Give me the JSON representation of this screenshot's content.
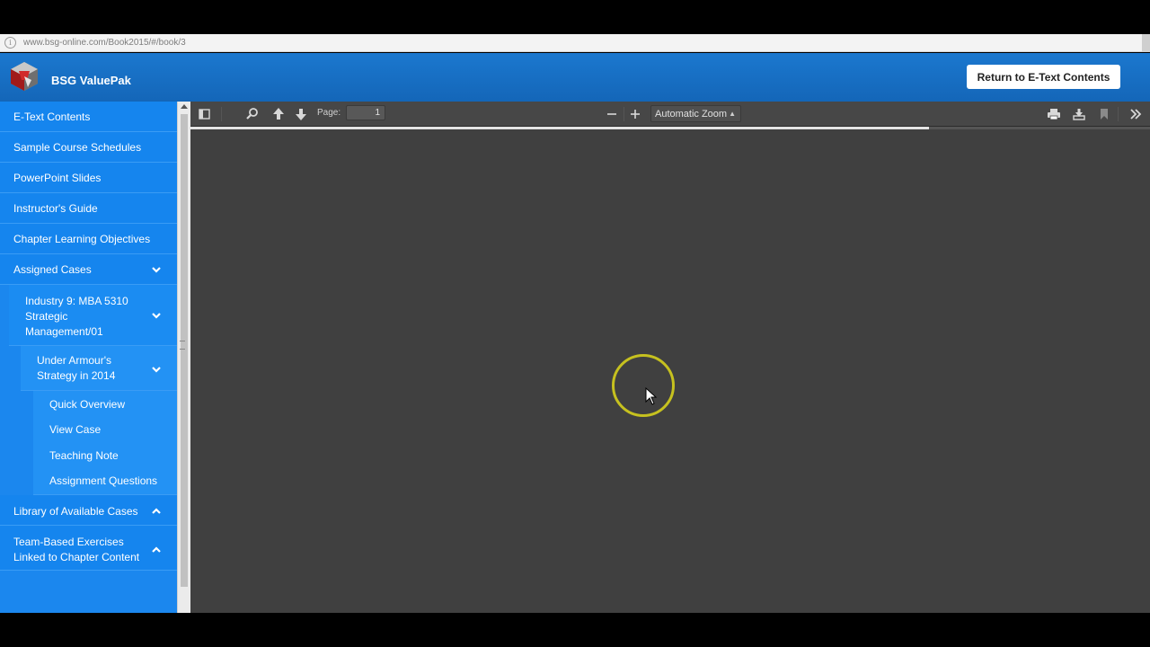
{
  "browser": {
    "url": "www.bsg-online.com/Book2015/#/book/3"
  },
  "header": {
    "brand": "BSG ValuePak",
    "return_button": "Return to E-Text Contents"
  },
  "sidebar": {
    "items": [
      {
        "label": "E-Text Contents"
      },
      {
        "label": "Sample Course Schedules"
      },
      {
        "label": "PowerPoint Slides"
      },
      {
        "label": "Instructor's Guide"
      },
      {
        "label": "Chapter Learning Objectives"
      },
      {
        "label": "Assigned Cases",
        "expanded": true
      },
      {
        "label": "Industry 9: MBA 5310 Strategic Management/01",
        "expanded": true
      },
      {
        "label": "Under Armour's Strategy in 2014",
        "expanded": true
      },
      {
        "label": "Quick Overview"
      },
      {
        "label": "View Case"
      },
      {
        "label": "Teaching Note"
      },
      {
        "label": "Assignment Questions"
      },
      {
        "label": "Library of Available Cases",
        "expanded": false
      },
      {
        "label": "Team-Based Exercises Linked to Chapter Content",
        "expanded": false
      }
    ]
  },
  "viewer": {
    "page_label": "Page:",
    "page_value": "1",
    "zoom_value": "Automatic Zoom",
    "load_progress": 0.77,
    "icons": [
      "sidebar-toggle-icon",
      "search-icon",
      "arrow-up-icon",
      "arrow-down-icon",
      "zoom-out-icon",
      "zoom-in-icon",
      "print-icon",
      "download-icon",
      "bookmark-icon",
      "tools-chevron-icon"
    ]
  },
  "colors": {
    "header": "#1671c6",
    "sidebar": "#1b87ee",
    "viewer_bg": "#404040",
    "toolbar": "#474747",
    "cursor_ring": "#c6c11f"
  }
}
